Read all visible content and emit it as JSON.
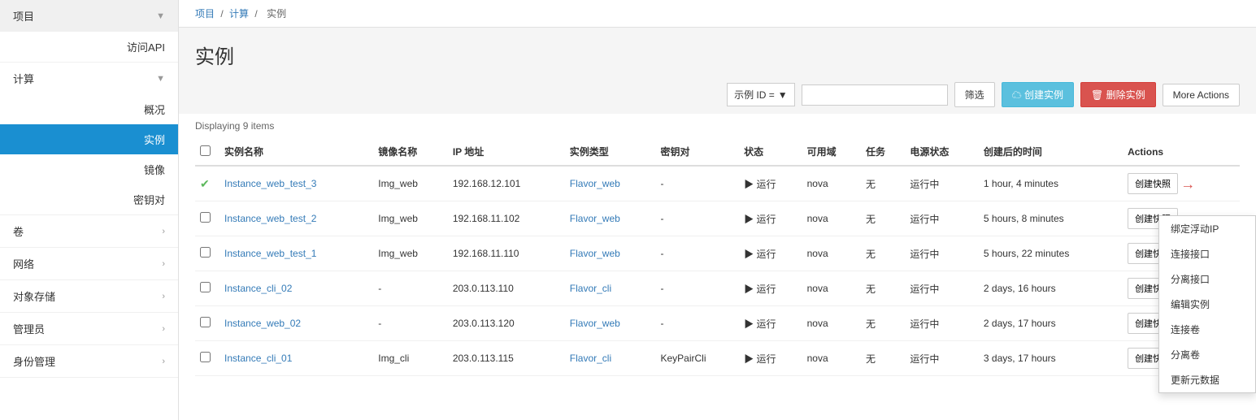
{
  "sidebar": {
    "project_label": "项目",
    "access_api_label": "访问API",
    "compute_label": "计算",
    "overview_label": "概况",
    "instances_label": "实例",
    "images_label": "镜像",
    "keypairs_label": "密钥对",
    "volumes_label": "卷",
    "network_label": "网络",
    "object_storage_label": "对象存储",
    "admin_label": "管理员",
    "identity_label": "身份管理"
  },
  "breadcrumb": {
    "project": "项目",
    "compute": "计算",
    "instances": "实例"
  },
  "page": {
    "title": "实例",
    "display_count": "Displaying 9 items"
  },
  "toolbar": {
    "filter_label": "示例 ID =",
    "filter_placeholder": "",
    "filter_btn": "筛选",
    "create_btn": "创建实例",
    "delete_btn": "删除实例",
    "more_actions_btn": "More Actions"
  },
  "table": {
    "headers": [
      "",
      "实例名称",
      "镜像名称",
      "IP 地址",
      "实例类型",
      "密钥对",
      "状态",
      "可用域",
      "任务",
      "电源状态",
      "创建后的时间",
      "Actions"
    ],
    "rows": [
      {
        "id": "1",
        "checked": true,
        "name": "Instance_web_test_3",
        "image": "Img_web",
        "ip": "192.168.12.101",
        "flavor": "Flavor_web",
        "keypair": "-",
        "status": "运行",
        "az": "nova",
        "task": "无",
        "power": "运行中",
        "time": "1 hour, 4 minutes",
        "action_btn": "创建快照",
        "has_arrow": true
      },
      {
        "id": "2",
        "checked": false,
        "name": "Instance_web_test_2",
        "image": "Img_web",
        "ip": "192.168.11.102",
        "flavor": "Flavor_web",
        "keypair": "-",
        "status": "运行",
        "az": "nova",
        "task": "无",
        "power": "运行中",
        "time": "5 hours, 8 minutes",
        "action_btn": "创建快照"
      },
      {
        "id": "3",
        "checked": false,
        "name": "Instance_web_test_1",
        "image": "Img_web",
        "ip": "192.168.11.110",
        "flavor": "Flavor_web",
        "keypair": "-",
        "status": "运行",
        "az": "nova",
        "task": "无",
        "power": "运行中",
        "time": "5 hours, 22 minutes",
        "action_btn": "创建快照"
      },
      {
        "id": "4",
        "checked": false,
        "name": "Instance_cli_02",
        "image": "-",
        "ip": "203.0.113.110",
        "flavor": "Flavor_cli",
        "keypair": "-",
        "status": "运行",
        "az": "nova",
        "task": "无",
        "power": "运行中",
        "time": "2 days, 16 hours",
        "action_btn": "创建快照"
      },
      {
        "id": "5",
        "checked": false,
        "name": "Instance_web_02",
        "image": "-",
        "ip": "203.0.113.120",
        "flavor": "Flavor_web",
        "keypair": "-",
        "status": "运行",
        "az": "nova",
        "task": "无",
        "power": "运行中",
        "time": "2 days, 17 hours",
        "action_btn": "创建快照"
      },
      {
        "id": "6",
        "checked": false,
        "name": "Instance_cli_01",
        "image": "Img_cli",
        "ip": "203.0.113.115",
        "flavor": "Flavor_cli",
        "keypair": "KeyPairCli",
        "status": "运行",
        "az": "nova",
        "task": "无",
        "power": "运行中",
        "time": "3 days, 17 hours",
        "action_btn": "创建快照"
      }
    ]
  },
  "dropdown": {
    "items": [
      "绑定浮动IP",
      "连接接口",
      "分离接口",
      "编辑实例",
      "连接卷",
      "分离卷",
      "更新元数据"
    ]
  },
  "colors": {
    "active_nav": "#1a8fd1",
    "link": "#337ab7",
    "delete_btn": "#d9534f",
    "create_btn": "#5bc0de"
  }
}
